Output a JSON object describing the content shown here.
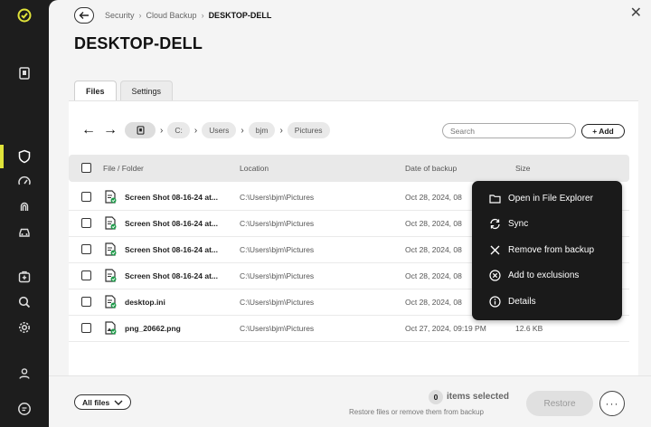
{
  "window": {
    "close_label": "✕"
  },
  "sidebar": {
    "items": [
      {
        "icon": "check-logo-icon"
      },
      {
        "icon": "computer-icon"
      },
      {
        "icon": "shield-icon",
        "active": true
      },
      {
        "icon": "speedometer-icon"
      },
      {
        "icon": "fingerprint-icon"
      },
      {
        "icon": "car-icon"
      },
      {
        "icon": "medical-kit-icon"
      },
      {
        "icon": "search-icon"
      },
      {
        "icon": "gear-icon"
      },
      {
        "icon": "user-icon"
      },
      {
        "icon": "chat-icon"
      }
    ],
    "accent": "#e0e33a"
  },
  "breadcrumb": {
    "items": [
      "Security",
      "Cloud Backup"
    ],
    "current": "DESKTOP-DELL"
  },
  "page_title": "DESKTOP-DELL",
  "tabs": [
    {
      "label": "Files",
      "active": true
    },
    {
      "label": "Settings",
      "active": false
    }
  ],
  "path": {
    "segments": [
      "C:",
      "Users",
      "bjm",
      "Pictures"
    ]
  },
  "search": {
    "placeholder": "Search"
  },
  "add_label": "+ Add",
  "table": {
    "headers": {
      "name": "File / Folder",
      "location": "Location",
      "date": "Date of backup",
      "size": "Size"
    },
    "rows": [
      {
        "name": "Screen Shot 08-16-24 at...",
        "location": "C:\\Users\\bjm\\Pictures",
        "date": "Oct 28, 2024, 08",
        "size": "",
        "icon": "file-synced-icon"
      },
      {
        "name": "Screen Shot 08-16-24 at...",
        "location": "C:\\Users\\bjm\\Pictures",
        "date": "Oct 28, 2024, 08",
        "size": "",
        "icon": "file-synced-icon"
      },
      {
        "name": "Screen Shot 08-16-24 at...",
        "location": "C:\\Users\\bjm\\Pictures",
        "date": "Oct 28, 2024, 08",
        "size": "",
        "icon": "file-synced-icon"
      },
      {
        "name": "Screen Shot 08-16-24 at...",
        "location": "C:\\Users\\bjm\\Pictures",
        "date": "Oct 28, 2024, 08",
        "size": "",
        "icon": "file-synced-icon"
      },
      {
        "name": "desktop.ini",
        "location": "C:\\Users\\bjm\\Pictures",
        "date": "Oct 28, 2024, 08",
        "size": "",
        "icon": "file-synced-icon"
      },
      {
        "name": "png_20662.png",
        "location": "C:\\Users\\bjm\\Pictures",
        "date": "Oct 27, 2024, 09:19 PM",
        "size": "12.6 KB",
        "icon": "image-synced-icon"
      }
    ]
  },
  "context_menu": {
    "items": [
      {
        "label": "Open in File Explorer",
        "icon": "folder-icon"
      },
      {
        "label": "Sync",
        "icon": "sync-icon"
      },
      {
        "label": "Remove from backup",
        "icon": "x-icon"
      },
      {
        "label": "Add to exclusions",
        "icon": "x-circle-icon"
      },
      {
        "label": "Details",
        "icon": "info-icon"
      }
    ]
  },
  "footer": {
    "filter_label": "All files",
    "selected_count": "0",
    "selected_label": "items selected",
    "hint": "Restore files or remove them from backup",
    "restore_label": "Restore",
    "more_label": "···"
  },
  "colors": {
    "sync_green": "#1f9a4a",
    "sidebar_bg": "#1d1d1d",
    "menu_bg": "#1a1a1a"
  }
}
